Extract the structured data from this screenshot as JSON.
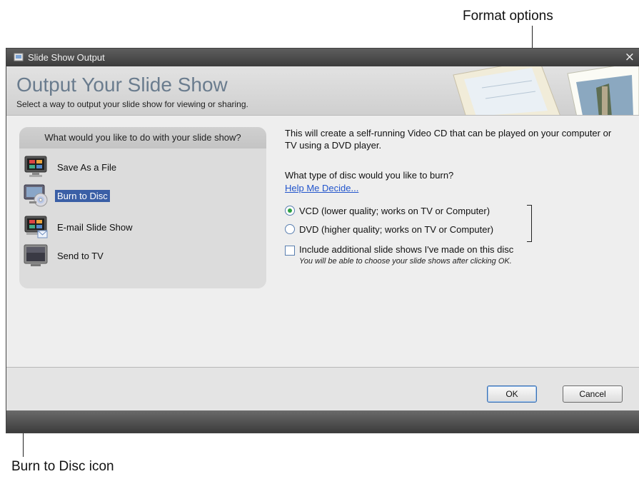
{
  "annotations": {
    "format_options": "Format options",
    "burn_to_disc_icon": "Burn to Disc icon"
  },
  "window": {
    "title": "Slide Show Output",
    "close_label": "×"
  },
  "header": {
    "title": "Output Your Slide Show",
    "subtitle": "Select a way to output your slide show for viewing or sharing."
  },
  "left_panel": {
    "heading": "What would you like to do with your slide show?",
    "options": [
      {
        "label": "Save As a File",
        "icon": "film-monitor-icon"
      },
      {
        "label": "Burn to Disc",
        "icon": "disc-burn-icon",
        "selected": true
      },
      {
        "label": "E-mail Slide Show",
        "icon": "email-monitor-icon"
      },
      {
        "label": "Send to TV",
        "icon": "tv-icon"
      }
    ]
  },
  "right_panel": {
    "description": "This will create a self-running Video CD that can be played on your computer or TV using a DVD player.",
    "question": "What type of disc would you like to burn?",
    "help_link": "Help Me Decide...",
    "radio_options": [
      {
        "label": "VCD (lower quality; works on TV or Computer)",
        "checked": true
      },
      {
        "label": "DVD (higher quality; works on TV or Computer)",
        "checked": false
      }
    ],
    "checkbox_label": "Include additional slide shows I've made on this disc",
    "checkbox_checked": false,
    "checkbox_note": "You will be able to choose your slide shows after clicking OK."
  },
  "buttons": {
    "ok": "OK",
    "cancel": "Cancel"
  },
  "colors": {
    "selection": "#3a5fa6",
    "radio_dot": "#2ea043",
    "link": "#2255cc"
  }
}
